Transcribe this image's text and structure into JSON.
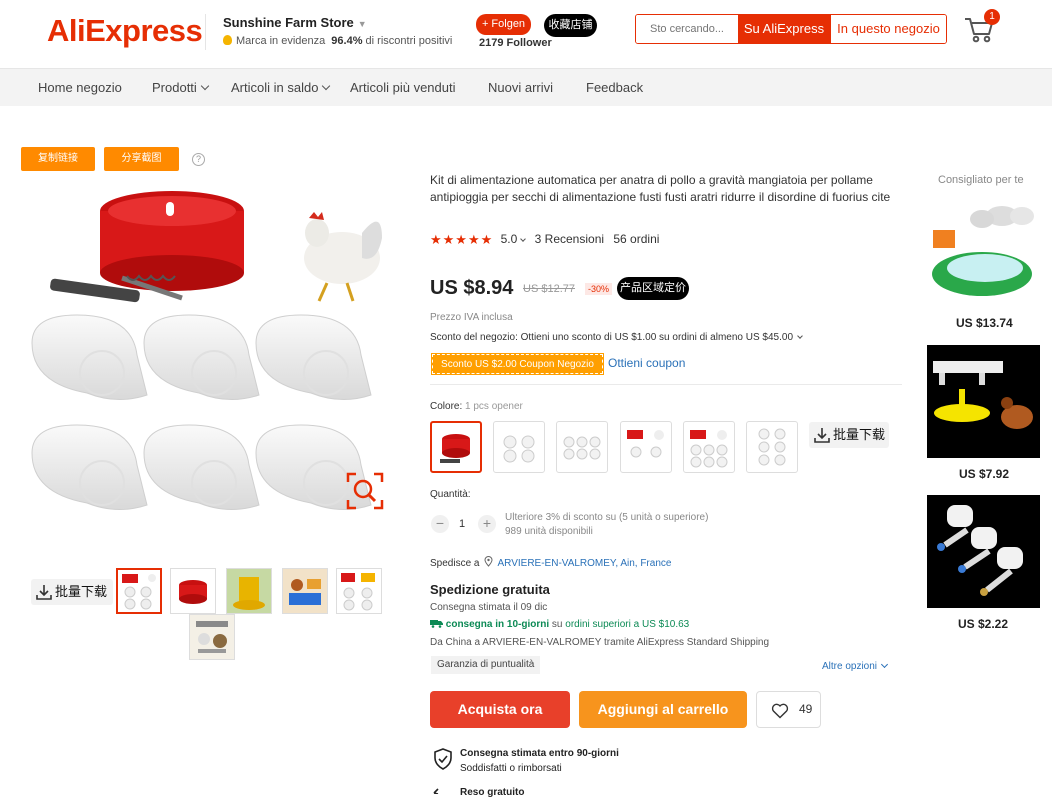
{
  "header": {
    "logo": "AliExpress",
    "store_name": "Sunshine Farm Store",
    "store_badge": "Marca in evidenza",
    "store_feedback_pct": "96.4%",
    "store_feedback_label": "di riscontri positivi",
    "follow_label": "+ Folgen",
    "followers": "2179 Follower",
    "favorite_store_label": "收藏店铺",
    "search_placeholder": "Sto cercando...",
    "search_all_label": "Su AliExpress",
    "search_store_label": "In questo negozio",
    "cart_count": "1"
  },
  "nav": {
    "items": [
      {
        "label": "Home negozio"
      },
      {
        "label": "Prodotti"
      },
      {
        "label": "Articoli in saldo"
      },
      {
        "label": "Articoli più venduti"
      },
      {
        "label": "Nuovi arrivi"
      },
      {
        "label": "Feedback"
      }
    ]
  },
  "tools": {
    "copy_link": "复制链接",
    "share_screenshot": "分享截图",
    "help": "?",
    "bulk_download": "批量下载"
  },
  "product": {
    "title": "Kit di alimentazione automatica per anatra di pollo a gravità mangiatoia per pollame antipioggia per secchi di alimentazione fusti fusti aratri ridurre il disordine di fuorius cite",
    "stars": "★★★★★",
    "rating": "5.0",
    "reviews": "3 Recensioni",
    "orders": "56 ordini",
    "price": "US $8.94",
    "old_price": "US $12.77",
    "discount": "-30%",
    "local_price_label": "产品区域定价",
    "vat": "Prezzo IVA inclusa",
    "store_discount": "Sconto del negozio: Ottieni uno sconto di US $1.00 su ordini di almeno US $45.00",
    "coupon": "Sconto US $2.00 Coupon Negozio",
    "get_coupon": "Ottieni coupon",
    "color_label": "Colore:",
    "color_value": "1 pcs opener",
    "quantity_label": "Quantità:",
    "quantity": "1",
    "qty_minus": "−",
    "qty_plus": "+",
    "qty_discount": "Ulteriore 3% di sconto su (5 unità o superiore)",
    "qty_available": "989 unità disponibili"
  },
  "shipping": {
    "ships_to_label": "Spedisce a",
    "ships_to": "ARVIERE-EN-VALROMEY, Ain, France",
    "free": "Spedizione gratuita",
    "estimate": "Consegna stimata il 09 dic",
    "fast": "consegna in 10-giorni",
    "fast_on": "su",
    "fast_threshold": "ordini superiori a US $10.63",
    "route": "Da China a ARVIERE-EN-VALROMEY tramite AliExpress Standard Shipping",
    "punctuality": "Garanzia di puntualità",
    "more_options": "Altre opzioni"
  },
  "actions": {
    "buy_now": "Acquista ora",
    "add_to_cart": "Aggiungi al carrello",
    "wishlist_count": "49"
  },
  "guarantee": {
    "title": "Consegna stimata entro 90-giorni",
    "subtitle": "Soddisfatti o rimborsati",
    "returns": "Reso gratuito"
  },
  "recommend": {
    "title": "Consigliato per te",
    "items": [
      {
        "price": "US $13.74"
      },
      {
        "price": "US $7.92"
      },
      {
        "price": "US $2.22"
      }
    ]
  },
  "colors": {
    "brand_red": "#e62e04",
    "orange": "#ff8a00",
    "link_blue": "#2a71b8",
    "green": "#0c8a55"
  }
}
